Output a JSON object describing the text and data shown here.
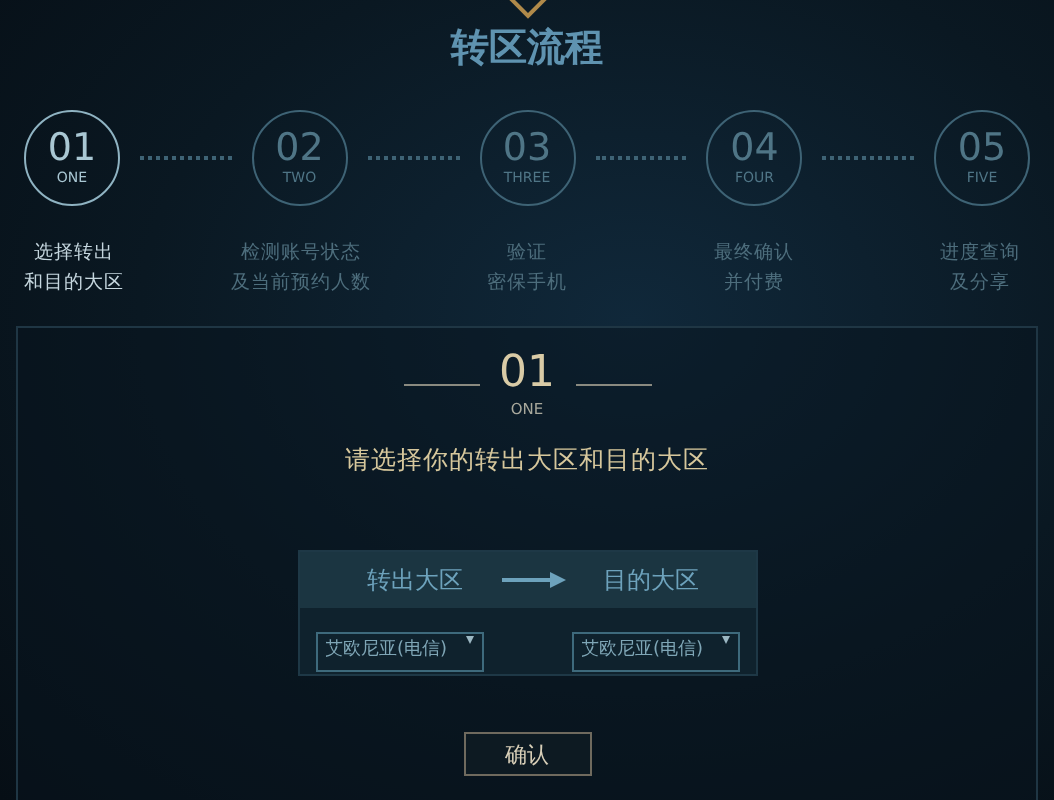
{
  "title": "转区流程",
  "steps": [
    {
      "number": "01",
      "word": "ONE",
      "lines": [
        "选择转出",
        "和目的大区"
      ],
      "selected": true
    },
    {
      "number": "02",
      "word": "TWO",
      "lines": [
        "检测账号状态",
        "及当前预约人数"
      ],
      "selected": false
    },
    {
      "number": "03",
      "word": "THREE",
      "lines": [
        "验证",
        "密保手机"
      ],
      "selected": false
    },
    {
      "number": "04",
      "word": "FOUR",
      "lines": [
        "最终确认",
        "并付费"
      ],
      "selected": false
    },
    {
      "number": "05",
      "word": "FIVE",
      "lines": [
        "进度查询",
        "及分享"
      ],
      "selected": false
    }
  ],
  "panel": {
    "number": "01",
    "word": "ONE",
    "instruction": "请选择你的转出大区和目的大区",
    "from_label": "转出大区",
    "to_label": "目的大区",
    "from_select": {
      "value": "艾欧尼亚(电信)"
    },
    "to_select": {
      "value": "艾欧尼亚(电信)"
    },
    "confirm_button": "确认"
  }
}
